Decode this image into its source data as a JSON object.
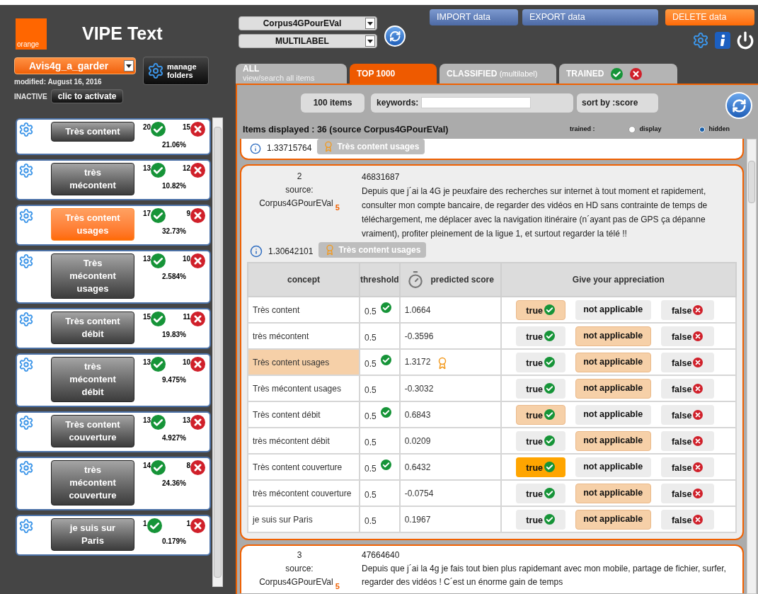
{
  "header": {
    "logo": "orange",
    "title": "VIPE Text"
  },
  "corpus_select": {
    "value": "Corpus4GPourEVal"
  },
  "mode_select": {
    "value": "MULTILABEL"
  },
  "actions": [
    {
      "label": "IMPORT data",
      "kind": "primary"
    },
    {
      "label": "EXPORT data",
      "kind": "primary"
    },
    {
      "label": "DELETE data",
      "kind": "danger"
    }
  ],
  "folder": {
    "value": "Avis4g_a_garder",
    "manage_label": "manage folders",
    "modified": "modified: August 16, 2016",
    "status": "INACTIVE",
    "activate_label": "clic to activate"
  },
  "concepts": [
    {
      "label": "Très content",
      "true_count": "20",
      "false_count": "15",
      "percent": "21.06%",
      "selected": false
    },
    {
      "label": "très mécontent",
      "true_count": "13",
      "false_count": "12",
      "percent": "10.82%",
      "selected": false
    },
    {
      "label": "Très content usages",
      "true_count": "17",
      "false_count": "9",
      "percent": "32.73%",
      "selected": true
    },
    {
      "label": "Très mécontent usages",
      "true_count": "13",
      "false_count": "10",
      "percent": "2.584%",
      "selected": false
    },
    {
      "label": "Très content débit",
      "true_count": "15",
      "false_count": "11",
      "percent": "19.83%",
      "selected": false
    },
    {
      "label": "très mécontent débit",
      "true_count": "13",
      "false_count": "10",
      "percent": "9.475%",
      "selected": false
    },
    {
      "label": "Très content couverture",
      "true_count": "13",
      "false_count": "13",
      "percent": "4.927%",
      "selected": false
    },
    {
      "label": "très mécontent couverture",
      "true_count": "14",
      "false_count": "8",
      "percent": "24.36%",
      "selected": false
    },
    {
      "label": "je suis sur Paris",
      "true_count": "1",
      "false_count": "1",
      "percent": "0.179%",
      "selected": false
    }
  ],
  "tabs": [
    {
      "label": "ALL",
      "note": "view/search all items",
      "kind": "stacked",
      "selected": false
    },
    {
      "label": "TOP 1000",
      "kind": "plain",
      "selected": true
    },
    {
      "label": "CLASSIFIED",
      "note": "(multilabel)",
      "kind": "inline",
      "selected": false
    },
    {
      "label": "TRAINED",
      "kind": "icons",
      "selected": false
    }
  ],
  "toolbar": {
    "count": "100 items",
    "keywords_label": "keywords:",
    "sort": "sort by :score"
  },
  "summary": "Items displayed : 36 (source Corpus4GPourEVal)",
  "trained_filter": {
    "label": "trained :",
    "options": [
      {
        "label": "display",
        "selected": false
      },
      {
        "label": "hidden",
        "selected": true
      }
    ]
  },
  "items": [
    {
      "kind": "tail",
      "score": "1.33715764",
      "badge": "Très content usages"
    },
    {
      "kind": "full",
      "index": "2",
      "source_label": "source:",
      "source": "Corpus4GPourEVal",
      "source_count": "5",
      "id": "46831687",
      "text": "Depuis que j´ai la 4G je peuxfaire des recherches sur internet à tout moment et rapidement, consulter mon compte bancaire, de regarder des vidéos en HD sans contrainte de temps de téléchargement, me déplacer avec la navigation itinéraire (n´ayant pas de GPS ça dépanne vraiment), profiter pleinement de la ligue 1, et surtout regarder la télé !!",
      "score": "1.30642101",
      "badge": "Très content usages",
      "table": {
        "columns": [
          {
            "label": "concept",
            "kind": "text"
          },
          {
            "label": "threshold",
            "kind": "text"
          },
          {
            "label": "predicted score",
            "kind": "timed"
          },
          {
            "label": "Give your appreciation",
            "kind": "text"
          }
        ],
        "rows": [
          {
            "concept": "Très content",
            "highlighted": false,
            "threshold": "0.5",
            "passed": true,
            "score": "1.0664",
            "top": false,
            "answers": [
              {
                "label": "true",
                "kind": "true",
                "suggested": true,
                "chosen": false
              },
              {
                "label": "not applicable",
                "kind": "na",
                "suggested": false,
                "chosen": false
              },
              {
                "label": "false",
                "kind": "false",
                "suggested": false,
                "chosen": false
              }
            ]
          },
          {
            "concept": "très mécontent",
            "highlighted": false,
            "threshold": "0.5",
            "passed": false,
            "score": "-0.3596",
            "top": false,
            "answers": [
              {
                "label": "true",
                "kind": "true",
                "suggested": false,
                "chosen": false
              },
              {
                "label": "not applicable",
                "kind": "na",
                "suggested": true,
                "chosen": false
              },
              {
                "label": "false",
                "kind": "false",
                "suggested": false,
                "chosen": false
              }
            ]
          },
          {
            "concept": "Très content usages",
            "highlighted": true,
            "threshold": "0.5",
            "passed": true,
            "score": "1.3172",
            "top": true,
            "answers": [
              {
                "label": "true",
                "kind": "true",
                "suggested": false,
                "chosen": false
              },
              {
                "label": "not applicable",
                "kind": "na",
                "suggested": true,
                "chosen": false
              },
              {
                "label": "false",
                "kind": "false",
                "suggested": false,
                "chosen": false
              }
            ]
          },
          {
            "concept": "Très mécontent usages",
            "highlighted": false,
            "threshold": "0.5",
            "passed": false,
            "score": "-0.3032",
            "top": false,
            "answers": [
              {
                "label": "true",
                "kind": "true",
                "suggested": false,
                "chosen": false
              },
              {
                "label": "not applicable",
                "kind": "na",
                "suggested": true,
                "chosen": false
              },
              {
                "label": "false",
                "kind": "false",
                "suggested": false,
                "chosen": false
              }
            ]
          },
          {
            "concept": "Très content débit",
            "highlighted": false,
            "threshold": "0.5",
            "passed": true,
            "score": "0.6843",
            "top": false,
            "answers": [
              {
                "label": "true",
                "kind": "true",
                "suggested": true,
                "chosen": false
              },
              {
                "label": "not applicable",
                "kind": "na",
                "suggested": false,
                "chosen": false
              },
              {
                "label": "false",
                "kind": "false",
                "suggested": false,
                "chosen": false
              }
            ]
          },
          {
            "concept": "très mécontent débit",
            "highlighted": false,
            "threshold": "0.5",
            "passed": false,
            "score": "0.0209",
            "top": false,
            "answers": [
              {
                "label": "true",
                "kind": "true",
                "suggested": false,
                "chosen": false
              },
              {
                "label": "not applicable",
                "kind": "na",
                "suggested": true,
                "chosen": false
              },
              {
                "label": "false",
                "kind": "false",
                "suggested": false,
                "chosen": false
              }
            ]
          },
          {
            "concept": "Très content couverture",
            "highlighted": false,
            "threshold": "0.5",
            "passed": true,
            "score": "0.6432",
            "top": false,
            "answers": [
              {
                "label": "true",
                "kind": "true",
                "suggested": false,
                "chosen": true
              },
              {
                "label": "not applicable",
                "kind": "na",
                "suggested": false,
                "chosen": false
              },
              {
                "label": "false",
                "kind": "false",
                "suggested": false,
                "chosen": false
              }
            ]
          },
          {
            "concept": "très mécontent couverture",
            "highlighted": false,
            "threshold": "0.5",
            "passed": false,
            "score": "-0.0754",
            "top": false,
            "answers": [
              {
                "label": "true",
                "kind": "true",
                "suggested": false,
                "chosen": false
              },
              {
                "label": "not applicable",
                "kind": "na",
                "suggested": true,
                "chosen": false
              },
              {
                "label": "false",
                "kind": "false",
                "suggested": false,
                "chosen": false
              }
            ]
          },
          {
            "concept": "je suis sur Paris",
            "highlighted": false,
            "threshold": "0.5",
            "passed": false,
            "score": "0.1967",
            "top": false,
            "answers": [
              {
                "label": "true",
                "kind": "true",
                "suggested": false,
                "chosen": false
              },
              {
                "label": "not applicable",
                "kind": "na",
                "suggested": true,
                "chosen": false
              },
              {
                "label": "false",
                "kind": "false",
                "suggested": false,
                "chosen": false
              }
            ]
          }
        ]
      }
    },
    {
      "kind": "head",
      "index": "3",
      "source_label": "source:",
      "source": "Corpus4GPourEVal",
      "source_count": "5",
      "id": "47664640",
      "text": "Depuis que j´ai la 4g je fais tout bien plus rapidemant avec mon mobile, partage de fichier, surfer, regarder des vidéos ! C´est un énorme gain de temps"
    }
  ]
}
